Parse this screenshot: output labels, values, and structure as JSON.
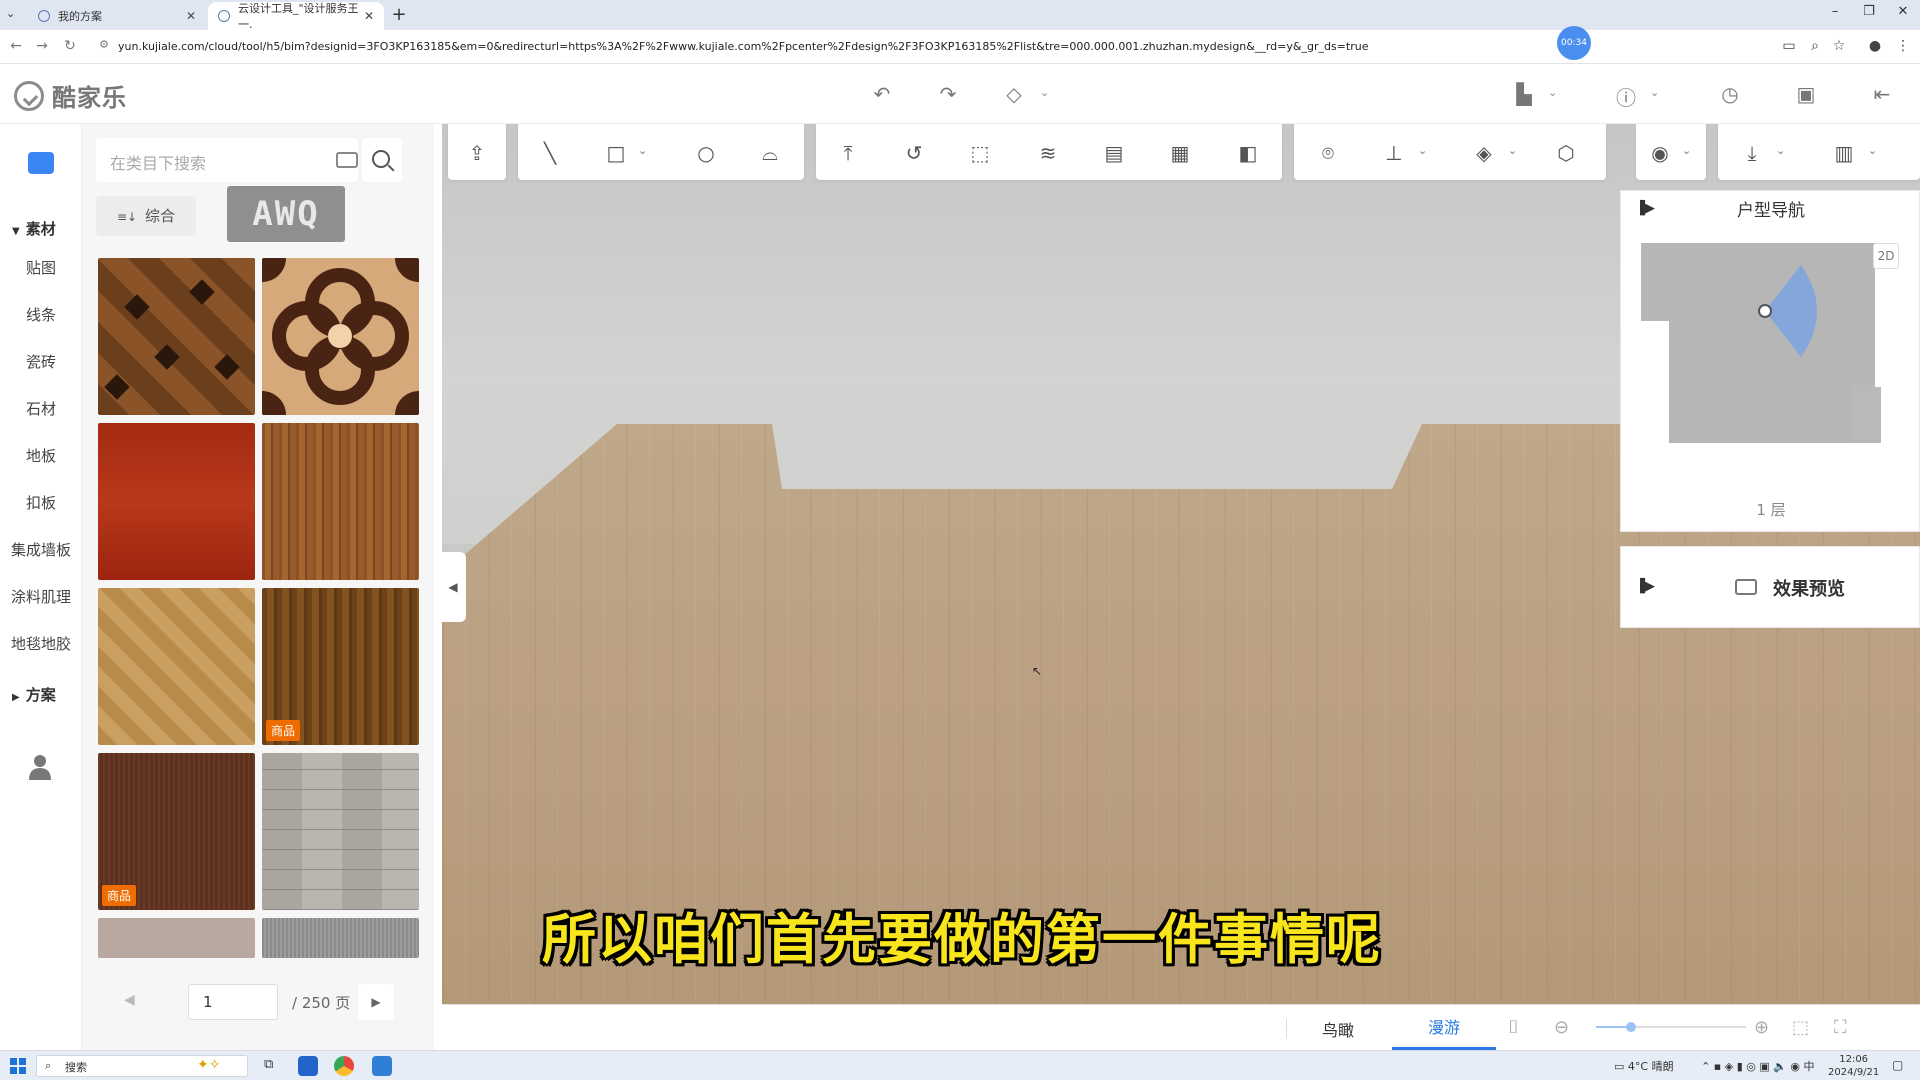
{
  "browser": {
    "tabs": [
      {
        "title": "我的方案",
        "close": "✕"
      },
      {
        "title": "云设计工具_\"设计服务王一.",
        "close": "✕"
      }
    ],
    "new_tab": "+",
    "window_controls": [
      "–",
      "❐",
      "✕"
    ],
    "url": "yun.kujiale.com/cloud/tool/h5/bim?designid=3FO3KP163185&em=0&redirecturl=https%3A%2F%2Fwww.kujiale.com%2Fpcenter%2Fdesign%2F3FO3KP163185%2Flist&tre=000.000.001.zhuzhan.mydesign&__rd=y&_gr_ds=true",
    "recording_time": "00:34"
  },
  "app": {
    "logo_text": "酷家乐",
    "brand_color": "#3b86f2",
    "header_icons": [
      "undo-icon",
      "redo-icon",
      "eraser-icon",
      "save-icon",
      "help-icon",
      "history-icon",
      "document-icon",
      "exit-icon"
    ]
  },
  "rail": {
    "section_materials": "素材",
    "items": [
      "贴图",
      "线条",
      "瓷砖",
      "石材",
      "地板",
      "扣板",
      "集成墙板",
      "涂料肌理",
      "地毯地胶"
    ],
    "section_plans": "方案"
  },
  "catalog": {
    "search_placeholder": "在类目下搜索",
    "sort_label": "综合",
    "watermark": "AWQ",
    "badge_label": "商品",
    "tiles": [
      {
        "name": "parquet-dark-diamond",
        "badge": false
      },
      {
        "name": "parquet-flower-inlay",
        "badge": false
      },
      {
        "name": "red-wood",
        "badge": false
      },
      {
        "name": "oak-plank",
        "badge": false
      },
      {
        "name": "herringbone-light",
        "badge": false
      },
      {
        "name": "brown-wood",
        "badge": true
      },
      {
        "name": "dark-walnut",
        "badge": true
      },
      {
        "name": "gray-plank",
        "badge": false
      }
    ],
    "page_current": "1",
    "page_total": "/ 250 页"
  },
  "viewport": {
    "subtitle": "所以咱们首先要做的第一件事情呢"
  },
  "nav_panel": {
    "title": "户型导航",
    "zoom_badge": "2D",
    "floor_label": "1 层"
  },
  "preview_panel": {
    "title": "效果预览"
  },
  "bottombar": {
    "bird_view": "鸟瞰",
    "roam_view": "漫游"
  },
  "taskbar": {
    "search_label": "搜索",
    "weather": "4°C 晴朗",
    "time": "12:06",
    "date": "2024/9/21",
    "ime": "中"
  }
}
